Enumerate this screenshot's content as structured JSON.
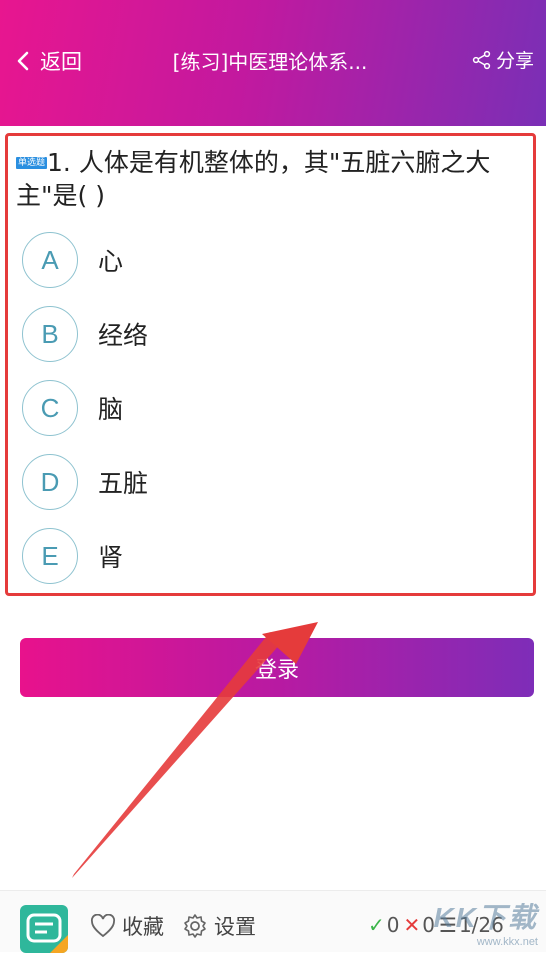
{
  "header": {
    "back_label": "返回",
    "title": "[练习]中医理论体系...",
    "share_label": "分享"
  },
  "question": {
    "badge": "单选题",
    "text": "1. 人体是有机整体的，其\"五脏六腑之大主\"是( )",
    "options": [
      {
        "letter": "A",
        "text": "心"
      },
      {
        "letter": "B",
        "text": "经络"
      },
      {
        "letter": "C",
        "text": "脑"
      },
      {
        "letter": "D",
        "text": "五脏"
      },
      {
        "letter": "E",
        "text": "肾"
      }
    ]
  },
  "login_button": "登录",
  "bottom": {
    "favorite_label": "收藏",
    "settings_label": "设置",
    "correct_count": "0",
    "wrong_count": "0",
    "progress": "1/26"
  },
  "watermark": {
    "main": "KK下载",
    "sub": "www.kkx.net"
  },
  "colors": {
    "header_start": "#e8168f",
    "header_end": "#7a2fb6",
    "highlight_border": "#e53b3b",
    "option_accent": "#4a9bb3"
  }
}
